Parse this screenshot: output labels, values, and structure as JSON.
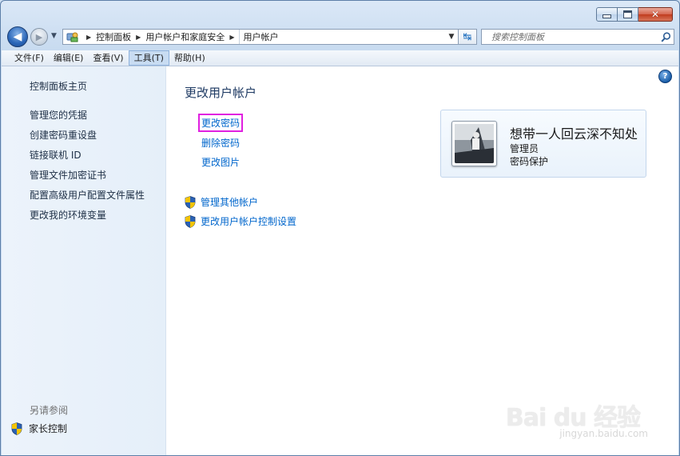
{
  "window": {
    "buttons": {
      "min_icon": "minimize-icon",
      "max_icon": "maximize-icon",
      "close": "✕"
    }
  },
  "nav": {
    "breadcrumbs": [
      "控制面板",
      "用户帐户和家庭安全",
      "用户帐户"
    ],
    "search_placeholder": "搜索控制面板"
  },
  "menu": [
    "文件(F)",
    "编辑(E)",
    "查看(V)",
    "工具(T)",
    "帮助(H)"
  ],
  "sidebar": {
    "home": "控制面板主页",
    "links": [
      "管理您的凭据",
      "创建密码重设盘",
      "链接联机 ID",
      "管理文件加密证书",
      "配置高级用户配置文件属性",
      "更改我的环境变量"
    ],
    "see_also": "另请参阅",
    "parental": "家长控制"
  },
  "main": {
    "title": "更改用户帐户",
    "tasks": [
      "更改密码",
      "删除密码",
      "更改图片"
    ],
    "shield_tasks": [
      "管理其他帐户",
      "更改用户帐户控制设置"
    ],
    "help": "?"
  },
  "user": {
    "name": "想带一人回云深不知处",
    "role": "管理员",
    "status": "密码保护"
  },
  "watermark": {
    "main": "Bai du 经验",
    "sub": "jingyan.baidu.com"
  },
  "colors": {
    "link": "#0066cc",
    "highlight": "#e020e0",
    "sidebar_bg": "#eaf2fb"
  }
}
